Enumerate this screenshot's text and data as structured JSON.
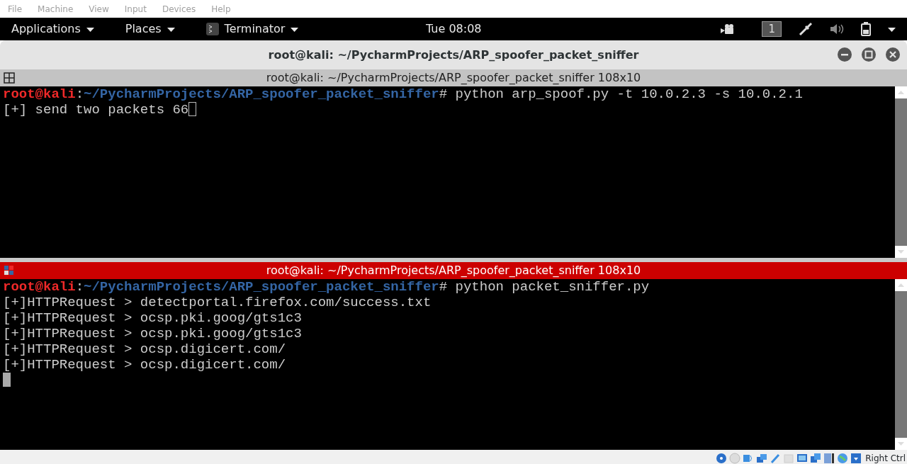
{
  "host_menu": [
    {
      "label": "File"
    },
    {
      "label": "Machine"
    },
    {
      "label": "View"
    },
    {
      "label": "Input"
    },
    {
      "label": "Devices"
    },
    {
      "label": "Help"
    }
  ],
  "top_panel": {
    "menus": [
      {
        "label": "Applications",
        "kind": "menu"
      },
      {
        "label": "Places",
        "kind": "menu"
      },
      {
        "label": "Terminator",
        "kind": "app"
      }
    ],
    "clock": "Tue 08:08",
    "workspace": "1"
  },
  "window": {
    "title": "root@kali: ~/PycharmProjects/ARP_spoofer_packet_sniffer"
  },
  "panes": [
    {
      "title": "root@kali: ~/PycharmProjects/ARP_spoofer_packet_sniffer 108x10",
      "focused": false,
      "lines": [
        {
          "kind": "prompt",
          "user": "root@kali",
          "sep": ":",
          "path": "~/PycharmProjects/ARP_spoofer_packet_sniffer",
          "command": "# python arp_spoof.py -t 10.0.2.3 -s 10.0.2.1",
          "cursor": false
        },
        {
          "kind": "output",
          "text": "[+] send two packets 66",
          "cursor": true
        }
      ]
    },
    {
      "title": "root@kali: ~/PycharmProjects/ARP_spoofer_packet_sniffer 108x10",
      "focused": true,
      "lines": [
        {
          "kind": "prompt",
          "user": "root@kali",
          "sep": ":",
          "path": "~/PycharmProjects/ARP_spoofer_packet_sniffer",
          "command": "# python packet_sniffer.py",
          "cursor": false
        },
        {
          "kind": "output",
          "text": "[+]HTTPRequest > detectportal.firefox.com/success.txt",
          "cursor": false
        },
        {
          "kind": "output",
          "text": "[+]HTTPRequest > ocsp.pki.goog/gts1c3",
          "cursor": false
        },
        {
          "kind": "output",
          "text": "[+]HTTPRequest > ocsp.pki.goog/gts1c3",
          "cursor": false
        },
        {
          "kind": "output",
          "text": "[+]HTTPRequest > ocsp.digicert.com/",
          "cursor": false
        },
        {
          "kind": "output",
          "text": "[+]HTTPRequest > ocsp.digicert.com/",
          "cursor": false
        },
        {
          "kind": "blank",
          "cursor": true
        }
      ]
    }
  ],
  "status_bar": {
    "host_key": "Right Ctrl"
  }
}
